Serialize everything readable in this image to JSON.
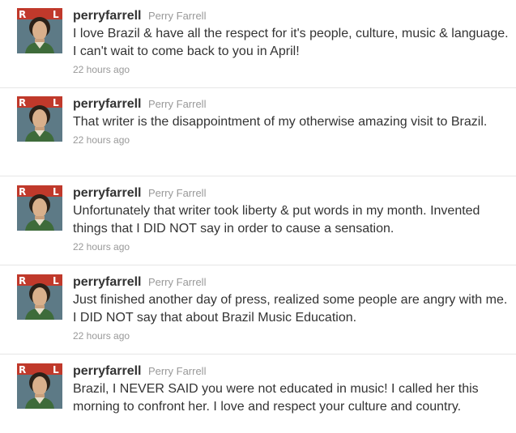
{
  "tweets": [
    {
      "screen_name": "perryfarrell",
      "full_name": "Perry Farrell",
      "text": "I love Brazil & have all the respect for it's people, culture, music & language. I can't wait to come back to you in April!",
      "timestamp": "22 hours ago"
    },
    {
      "screen_name": "perryfarrell",
      "full_name": "Perry Farrell",
      "text": "That writer is the disappointment of my otherwise amazing visit to Brazil.",
      "timestamp": "22 hours ago"
    },
    {
      "screen_name": "perryfarrell",
      "full_name": "Perry Farrell",
      "text": "Unfortunately that writer took liberty & put words in my month. Invented things that I DID NOT say in order to cause a sensation.",
      "timestamp": "22 hours ago"
    },
    {
      "screen_name": "perryfarrell",
      "full_name": "Perry Farrell",
      "text": "Just finished another day of press, realized some people are angry with me. I DID NOT say that about Brazil Music Education.",
      "timestamp": "22 hours ago"
    },
    {
      "screen_name": "perryfarrell",
      "full_name": "Perry Farrell",
      "text": "Brazil, I NEVER SAID you were not educated in music! I called her this morning to confront her. I love and respect your culture and country.",
      "timestamp": ""
    }
  ],
  "colors": {
    "text": "#333333",
    "meta": "#999999",
    "divider": "#e6e6e6"
  },
  "icons": {
    "avatar": "profile-photo"
  }
}
